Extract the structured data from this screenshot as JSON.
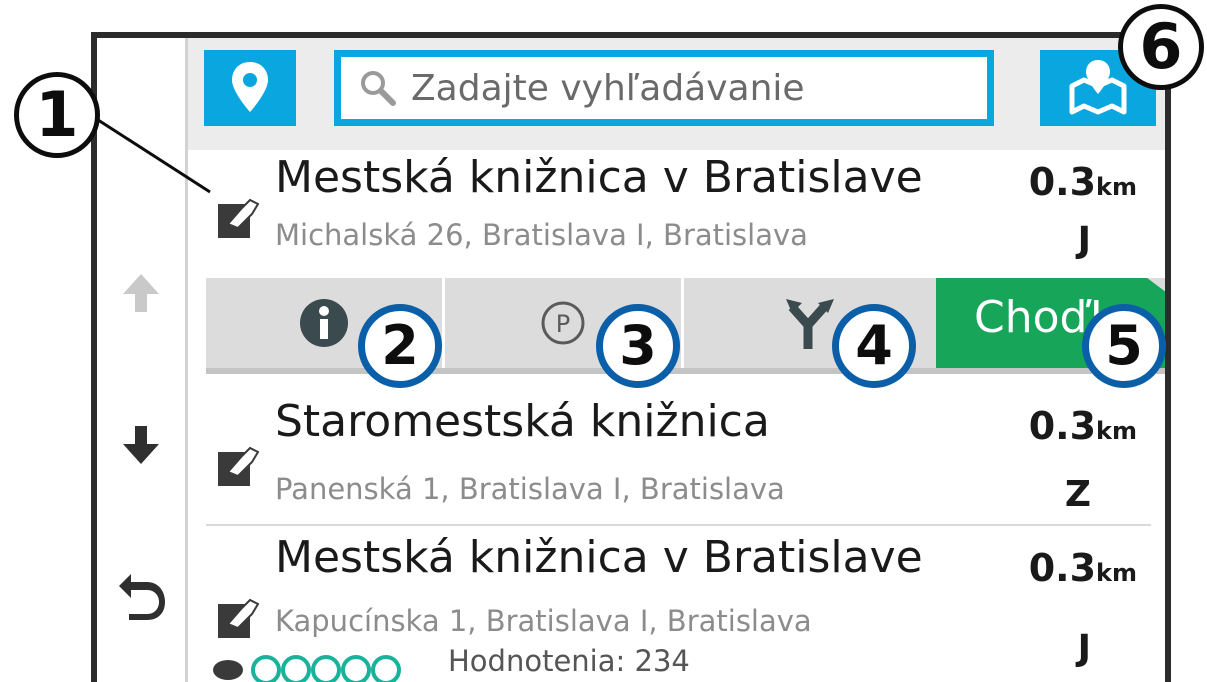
{
  "search": {
    "placeholder": "Zadajte vyhľadávanie"
  },
  "results": [
    {
      "title": "Mestská knižnica v Bratislave",
      "address": "Michalská 26, Bratislava I, Bratislava",
      "distance": "0.3",
      "unit": "km",
      "direction": "J"
    },
    {
      "title": "Staromestská knižnica",
      "address": "Panenská 1, Bratislava I, Bratislava",
      "distance": "0.3",
      "unit": "km",
      "direction": "Z"
    },
    {
      "title": "Mestská knižnica v Bratislave",
      "address": "Kapucínska 1, Bratislava I, Bratislava",
      "distance": "0.3",
      "unit": "km",
      "direction": "J",
      "rating_text": "Hodnotenia: 234"
    }
  ],
  "actions": {
    "go_label": "Choď!"
  },
  "callouts": [
    "1",
    "2",
    "3",
    "4",
    "5",
    "6"
  ],
  "colors": {
    "accent": "#0aa6e0",
    "go": "#17a55a",
    "callout_border": "#0b5fa8"
  },
  "icons": {
    "location": "map-pin-icon",
    "search": "magnifier-icon",
    "map": "map-icon",
    "poi": "library-icon",
    "info": "info-icon",
    "parking": "parking-icon",
    "routes": "route-fork-icon",
    "up": "arrow-up-icon",
    "down": "arrow-down-icon",
    "back": "back-arrow-icon"
  }
}
